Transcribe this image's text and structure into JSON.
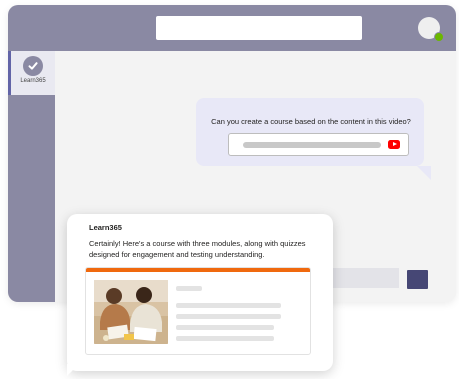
{
  "sidebar": {
    "app": {
      "label": "Learn365",
      "icon": "check-icon"
    }
  },
  "conversation": {
    "user_message": "Can you create a course based on the content in this video?",
    "attachment_icon": "youtube-icon"
  },
  "bot": {
    "name": "Learn365",
    "message": "Certainly! Here's a course with three modules, along with quizzes designed for engagement and testing understanding.",
    "course_card": {
      "thumbnail": "people-collaborating-image",
      "progress": 1.0
    }
  },
  "colors": {
    "titlebar": "#8a89a3",
    "accent": "#464775",
    "progress": "#f0690e",
    "presence": "#6bb700",
    "youtube": "#ff0000"
  }
}
